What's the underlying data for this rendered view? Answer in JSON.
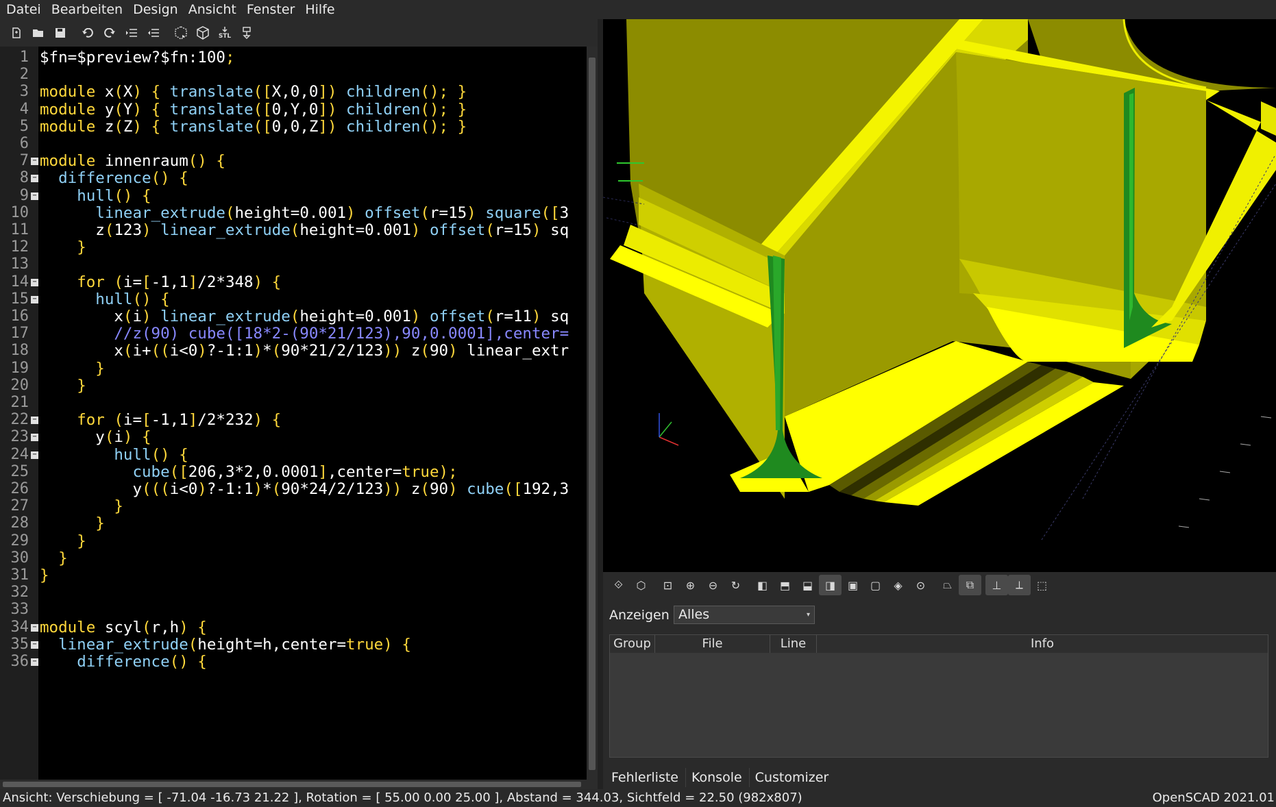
{
  "menu": [
    "Datei",
    "Bearbeiten",
    "Design",
    "Ansicht",
    "Fenster",
    "Hilfe"
  ],
  "toolbar": {
    "icons": [
      "new-file-icon",
      "open-file-icon",
      "save-icon",
      "undo-icon",
      "redo-icon",
      "indent-icon",
      "unindent-icon",
      "preview-icon",
      "render-icon",
      "export-stl-icon",
      "send-to-print-icon"
    ],
    "stl_label": "STL"
  },
  "editor": {
    "line_numbers": [
      "1",
      "2",
      "3",
      "4",
      "5",
      "6",
      "7",
      "8",
      "9",
      "10",
      "11",
      "12",
      "13",
      "14",
      "15",
      "16",
      "17",
      "18",
      "19",
      "20",
      "21",
      "22",
      "23",
      "24",
      "25",
      "26",
      "27",
      "28",
      "29",
      "30",
      "31",
      "32",
      "33",
      "34",
      "35",
      "36"
    ],
    "lines": [
      "$fn=$preview?$fn:100;",
      "",
      "module x(X) { translate([X,0,0]) children(); }",
      "module y(Y) { translate([0,Y,0]) children(); }",
      "module z(Z) { translate([0,0,Z]) children(); }",
      "",
      "module innenraum() {",
      "  difference() {",
      "    hull() {",
      "      linear_extrude(height=0.001) offset(r=15) square([3",
      "      z(123) linear_extrude(height=0.001) offset(r=15) sq",
      "    }",
      "",
      "    for (i=[-1,1]/2*348) {",
      "      hull() {",
      "        x(i) linear_extrude(height=0.001) offset(r=11) sq",
      "        //z(90) cube([18*2-(90*21/123),90,0.0001],center=",
      "        x(i+((i<0)?-1:1)*(90*21/2/123)) z(90) linear_extr",
      "      }",
      "    }",
      "",
      "    for (i=[-1,1]/2*232) {",
      "      y(i) {",
      "        hull() {",
      "          cube([206,3*2,0.0001],center=true);",
      "          y(((i<0)?-1:1)*(90*24/2/123)) z(90) cube([192,3",
      "        }",
      "      }",
      "    }",
      "  }",
      "}",
      "",
      "",
      "module scyl(r,h) {",
      "  linear_extrude(height=h,center=true) {",
      "    difference() {"
    ],
    "fold_lines": [
      7,
      8,
      9,
      14,
      15,
      22,
      23,
      24,
      34,
      35,
      36
    ]
  },
  "view_toolbar": {
    "icons": [
      "preview-icon",
      "render-icon",
      "view-all-icon",
      "zoom-in-icon",
      "zoom-out-icon",
      "reset-view-icon",
      "view-right-icon",
      "view-top-icon",
      "view-bottom-icon",
      "view-left-icon",
      "view-front-icon",
      "view-back-icon",
      "view-diagonal-icon",
      "view-center-icon",
      "perspective-icon",
      "orthogonal-icon",
      "show-axes-icon",
      "show-scale-icon",
      "show-edges-icon"
    ],
    "active": [
      "view-left-icon",
      "orthogonal-icon",
      "show-axes-icon",
      "show-scale-icon"
    ]
  },
  "errors_panel": {
    "show_label": "Anzeigen",
    "show_value": "Alles",
    "columns": [
      "Group",
      "File",
      "Line",
      "Info"
    ]
  },
  "tabs": [
    "Fehlerliste",
    "Konsole",
    "Customizer"
  ],
  "status": {
    "left": "Ansicht: Verschiebung = [ -71.04 -16.73 21.22 ], Rotation = [ 55.00 0.00 25.00 ], Abstand = 344.03, Sichtfeld = 22.50 (982x807)",
    "right": "OpenSCAD 2021.01"
  },
  "colors": {
    "editor_bg": "#000000",
    "keyword": "#ffd83b",
    "builtin": "#8fd0f5",
    "comment": "#8888ff",
    "model_yellow": "#ffff00",
    "model_olive": "#8c8c00",
    "model_green": "#1f8a1f"
  }
}
